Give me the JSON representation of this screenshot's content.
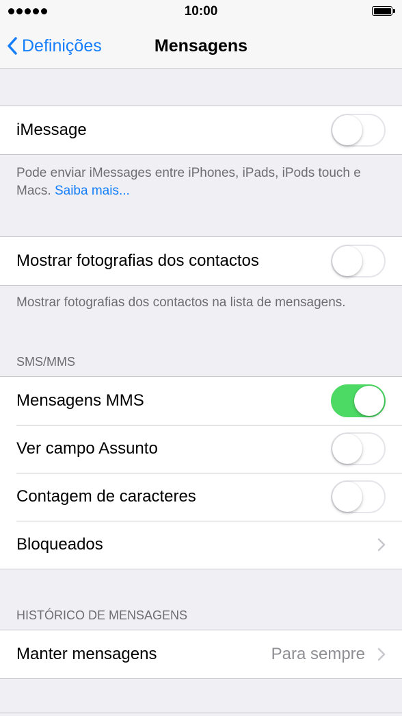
{
  "status_bar": {
    "time": "10:00",
    "signal": "signal-dots-icon",
    "battery": "battery-full-icon"
  },
  "nav": {
    "back_label": "Definições",
    "title": "Mensagens"
  },
  "imessage": {
    "label": "iMessage",
    "on": false,
    "footer_text": "Pode enviar iMessages entre iPhones, iPads, iPods touch e Macs. ",
    "footer_link": "Saiba mais..."
  },
  "contact_photos": {
    "label": "Mostrar fotografias dos contactos",
    "on": false,
    "footer_text": "Mostrar fotografias dos contactos na lista de mensagens."
  },
  "sms_mms": {
    "header": "SMS/MMS",
    "mms": {
      "label": "Mensagens MMS",
      "on": true
    },
    "subject": {
      "label": "Ver campo Assunto",
      "on": false
    },
    "char_count": {
      "label": "Contagem de caracteres",
      "on": false
    },
    "blocked": {
      "label": "Bloqueados"
    }
  },
  "history": {
    "header": "HISTÓRICO DE MENSAGENS",
    "keep": {
      "label": "Manter mensagens",
      "value": "Para sempre"
    }
  },
  "colors": {
    "accent": "#147efb",
    "toggle_on": "#4cd964",
    "background": "#efeff4"
  }
}
